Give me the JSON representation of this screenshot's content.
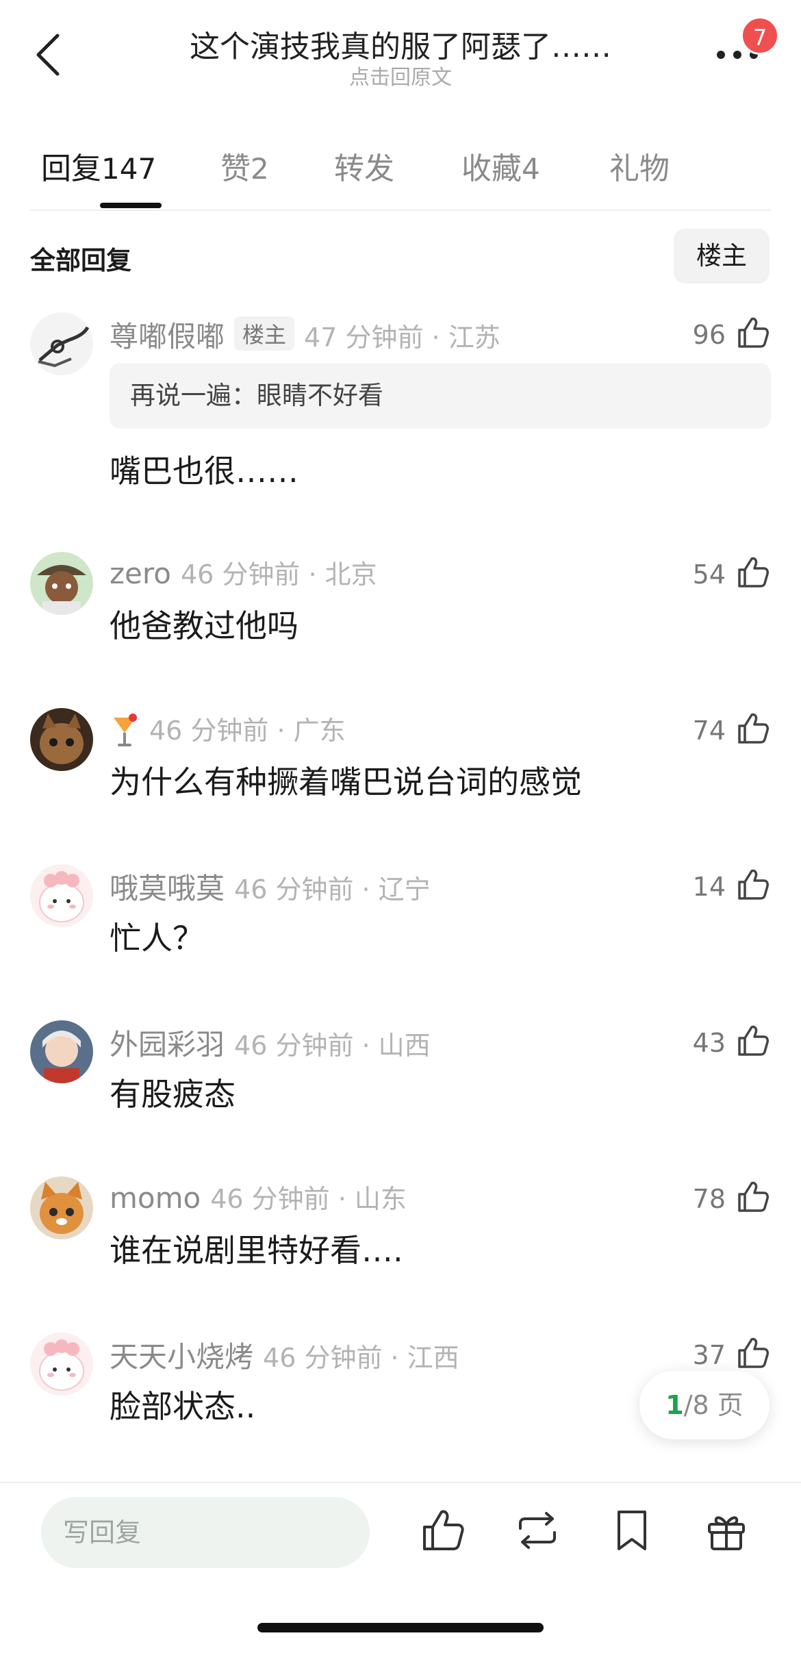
{
  "header": {
    "title": "这个演技我真的服了阿瑟了……",
    "subtitle": "点击回原文",
    "notification_count": "7",
    "icons": {
      "back": "back-arrow-icon",
      "more": "more-dots-icon"
    }
  },
  "tabs": [
    {
      "label": "回复",
      "count": "147",
      "active": true
    },
    {
      "label": "赞",
      "count": "2",
      "active": false
    },
    {
      "label": "转发",
      "count": "",
      "active": false
    },
    {
      "label": "收藏",
      "count": "4",
      "active": false
    },
    {
      "label": "礼物",
      "count": "",
      "active": false
    }
  ],
  "filter": {
    "all_replies": "全部回复",
    "op_only": "楼主"
  },
  "comments": [
    {
      "user": "尊嘟假嘟",
      "op_label": "楼主",
      "time": "47 分钟前 · 江苏",
      "likes": "96",
      "quote": "再说一遍：眼睛不好看",
      "text": "嘴巴也很……"
    },
    {
      "user": "zero",
      "time": "46 分钟前 · 北京",
      "likes": "54",
      "text": "他爸教过他吗"
    },
    {
      "user_icon": "cocktail-emoji-icon",
      "time": "46 分钟前 · 广东",
      "likes": "74",
      "text": "为什么有种撅着嘴巴说台词的感觉"
    },
    {
      "user": "哦莫哦莫",
      "time": "46 分钟前 · 辽宁",
      "likes": "14",
      "text": "忙人？"
    },
    {
      "user": "外园彩羽",
      "time": "46 分钟前 · 山西",
      "likes": "43",
      "text": "有股疲态"
    },
    {
      "user": "momo",
      "time": "46 分钟前 · 山东",
      "likes": "78",
      "text": "谁在说剧里特好看…."
    },
    {
      "user": "天天小烧烤",
      "time": "46 分钟前 · 江西",
      "likes": "37",
      "text": "脸部状态.."
    }
  ],
  "pager": {
    "current": "1",
    "rest": "/8 页"
  },
  "bottom_bar": {
    "reply_placeholder": "写回复",
    "icons": [
      "like-icon",
      "repost-icon",
      "bookmark-icon",
      "gift-icon"
    ]
  },
  "colors": {
    "accent_green": "#1fa24a",
    "badge_red": "#f04f4f"
  }
}
